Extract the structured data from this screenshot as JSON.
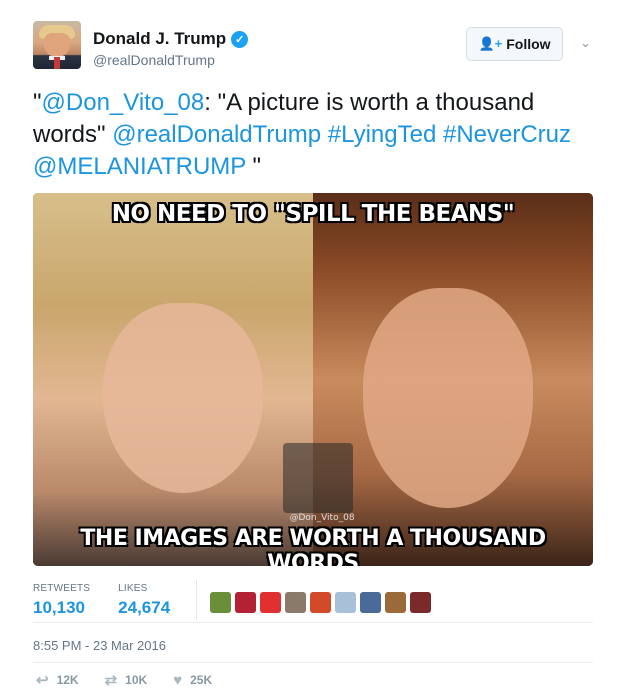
{
  "author": {
    "name": "Donald J. Trump",
    "handle": "@realDonaldTrump",
    "verified_icon": "verified-badge-icon"
  },
  "follow_button": {
    "label": "Follow",
    "icon": "add-user-icon"
  },
  "menu": {
    "icon": "chevron-down-icon"
  },
  "tweet": {
    "parts": [
      {
        "text": "\"",
        "type": "plain"
      },
      {
        "text": "@Don_Vito_08",
        "type": "link"
      },
      {
        "text": ": \"A picture is worth a thousand words\" ",
        "type": "plain"
      },
      {
        "text": "@realDonaldTrump",
        "type": "link"
      },
      {
        "text": "  ",
        "type": "plain"
      },
      {
        "text": "#LyingTed",
        "type": "link"
      },
      {
        "text": " ",
        "type": "plain"
      },
      {
        "text": "#NeverCruz",
        "type": "link"
      },
      {
        "text": "  ",
        "type": "plain"
      },
      {
        "text": "@MELANIATRUMP",
        "type": "link"
      },
      {
        "text": " \"",
        "type": "plain"
      }
    ]
  },
  "image": {
    "top_caption": "NO NEED TO \"SPILL THE BEANS\"",
    "bottom_caption": "THE IMAGES ARE WORTH A THOUSAND WORDS",
    "watermark": "@Don_Vito_08"
  },
  "stats": {
    "retweets_label": "RETWEETS",
    "retweets_value": "10,130",
    "likes_label": "LIKES",
    "likes_value": "24,674"
  },
  "likers_colors": [
    "#6b8e3a",
    "#b22234",
    "#e03030",
    "#8a7a6a",
    "#d24a2a",
    "#a8c0d8",
    "#4a6a9a",
    "#9a6a3a",
    "#7a2a2a"
  ],
  "timestamp": "8:55 PM - 23 Mar 2016",
  "actions": {
    "reply_count": "12K",
    "retweet_count": "10K",
    "like_count": "25K"
  }
}
